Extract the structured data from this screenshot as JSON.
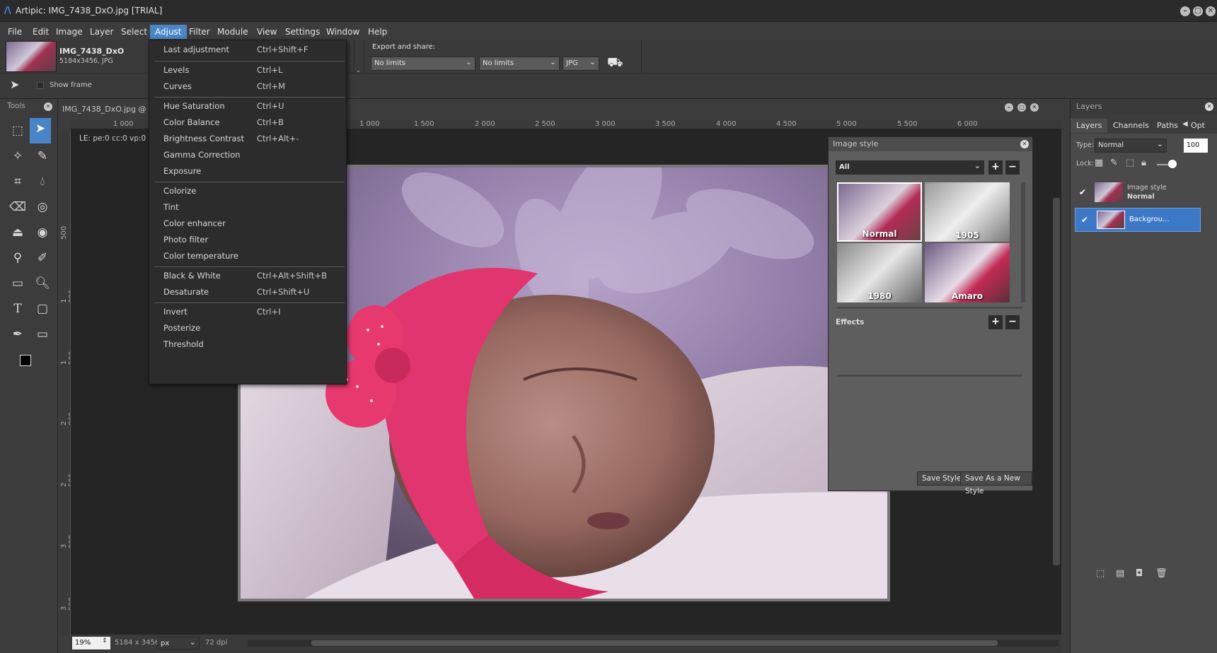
{
  "app": {
    "title": "Artipic: IMG_7438_DxO.jpg [TRIAL]"
  },
  "menubar": {
    "items": [
      "File",
      "Edit",
      "Image",
      "Layer",
      "Select",
      "Adjust",
      "Filter",
      "Module",
      "View",
      "Settings",
      "Window",
      "Help"
    ],
    "active": "Adjust"
  },
  "file_info": {
    "name": "IMG_7438_DxO",
    "size": "5184x3456,  JPG"
  },
  "options": {
    "show_frame": "Show frame",
    "export_label": "Export and share:",
    "limit1": "No limits",
    "limit2": "No limits",
    "format": "JPG"
  },
  "tools": {
    "header": "Tools"
  },
  "document": {
    "tab": "IMG_7438_DxO.jpg @",
    "overlay": "LE: pe:0 cc:0 vp:0",
    "ruler_top": [
      "1 000",
      "1 000",
      "1 500",
      "2 000",
      "2 500",
      "3 000",
      "3 500",
      "4 000",
      "4 500",
      "5 000",
      "5 500",
      "6 000"
    ],
    "ruler_left": [
      "500",
      "1 000",
      "1 500",
      "2 000",
      "2 500",
      "3 000",
      "3 500"
    ]
  },
  "status": {
    "zoom": "19%",
    "dimensions": "5184 x 3456",
    "unit": "px",
    "dpi": "72  dpi"
  },
  "adjust_menu": {
    "groups": [
      [
        {
          "label": "Last adjustment",
          "shortcut": "Ctrl+Shift+F"
        }
      ],
      [
        {
          "label": "Levels",
          "shortcut": "Ctrl+L"
        },
        {
          "label": "Curves",
          "shortcut": "Ctrl+M"
        }
      ],
      [
        {
          "label": "Hue Saturation",
          "shortcut": "Ctrl+U"
        },
        {
          "label": "Color Balance",
          "shortcut": "Ctrl+B"
        },
        {
          "label": "Brightness Contrast",
          "shortcut": "Ctrl+Alt+-"
        },
        {
          "label": "Gamma Correction",
          "shortcut": ""
        },
        {
          "label": "Exposure",
          "shortcut": ""
        }
      ],
      [
        {
          "label": "Colorize",
          "shortcut": ""
        },
        {
          "label": "Tint",
          "shortcut": ""
        },
        {
          "label": "Color enhancer",
          "shortcut": ""
        },
        {
          "label": "Photo filter",
          "shortcut": ""
        },
        {
          "label": "Color temperature",
          "shortcut": ""
        }
      ],
      [
        {
          "label": "Black & White",
          "shortcut": "Ctrl+Alt+Shift+B"
        },
        {
          "label": "Desaturate",
          "shortcut": "Ctrl+Shift+U"
        }
      ],
      [
        {
          "label": "Invert",
          "shortcut": "Ctrl+I"
        },
        {
          "label": "Posterize",
          "shortcut": ""
        },
        {
          "label": "Threshold",
          "shortcut": ""
        }
      ]
    ]
  },
  "image_style": {
    "title": "Image style",
    "filter": "All",
    "styles": [
      "Normal",
      "1905",
      "1980",
      "Amaro"
    ],
    "effects_label": "Effects",
    "save_style": "Save Style",
    "save_new": "Save As a New Style"
  },
  "layers": {
    "header": "Layers",
    "tabs": [
      "Layers",
      "Channels",
      "Paths",
      "Opt"
    ],
    "type_label": "Type:",
    "blend": "Normal",
    "opacity": "100",
    "lock_label": "Lock:",
    "items": [
      {
        "name": "Image style",
        "sub": "Normal"
      },
      {
        "name": "Backgrou..."
      }
    ]
  }
}
